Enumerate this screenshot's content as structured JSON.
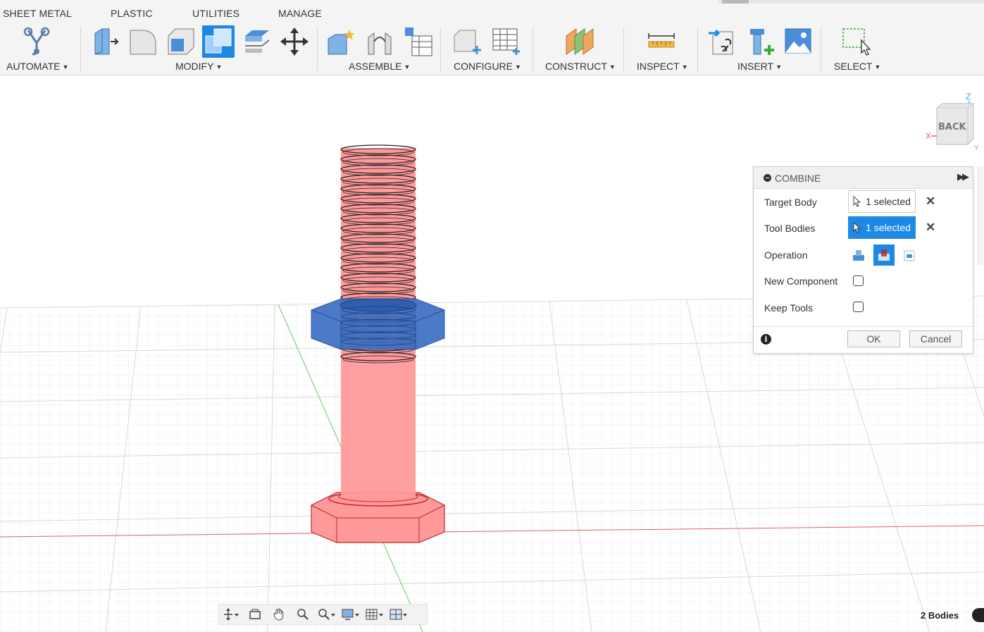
{
  "tabs": [
    "SHEET METAL",
    "PLASTIC",
    "UTILITIES",
    "MANAGE"
  ],
  "groups": {
    "automate": "AUTOMATE",
    "modify": "MODIFY",
    "assemble": "ASSEMBLE",
    "configure": "CONFIGURE",
    "construct": "CONSTRUCT",
    "inspect": "INSPECT",
    "insert": "INSERT",
    "select": "SELECT"
  },
  "colors": {
    "accent": "#1e88e5",
    "bolt_fill": "#ff9a9a",
    "bolt_edge": "#c0262b",
    "nut_fill": "#3b6fc4",
    "axis_x": "#e06060",
    "axis_y": "#66cc66"
  },
  "viewcube": {
    "face": "BACK",
    "z": "Z",
    "x": "X",
    "y": "Y"
  },
  "combine": {
    "title": "COMBINE",
    "target_body_label": "Target Body",
    "target_body_value": "1 selected",
    "tool_bodies_label": "Tool Bodies",
    "tool_bodies_value": "1 selected",
    "operation_label": "Operation",
    "operation_options": [
      "join-icon",
      "cut-icon",
      "intersect-icon"
    ],
    "operation_selected": "cut",
    "new_component_label": "New Component",
    "keep_tools_label": "Keep Tools",
    "ok": "OK",
    "cancel": "Cancel"
  },
  "status": {
    "bodies": "2 Bodies"
  }
}
